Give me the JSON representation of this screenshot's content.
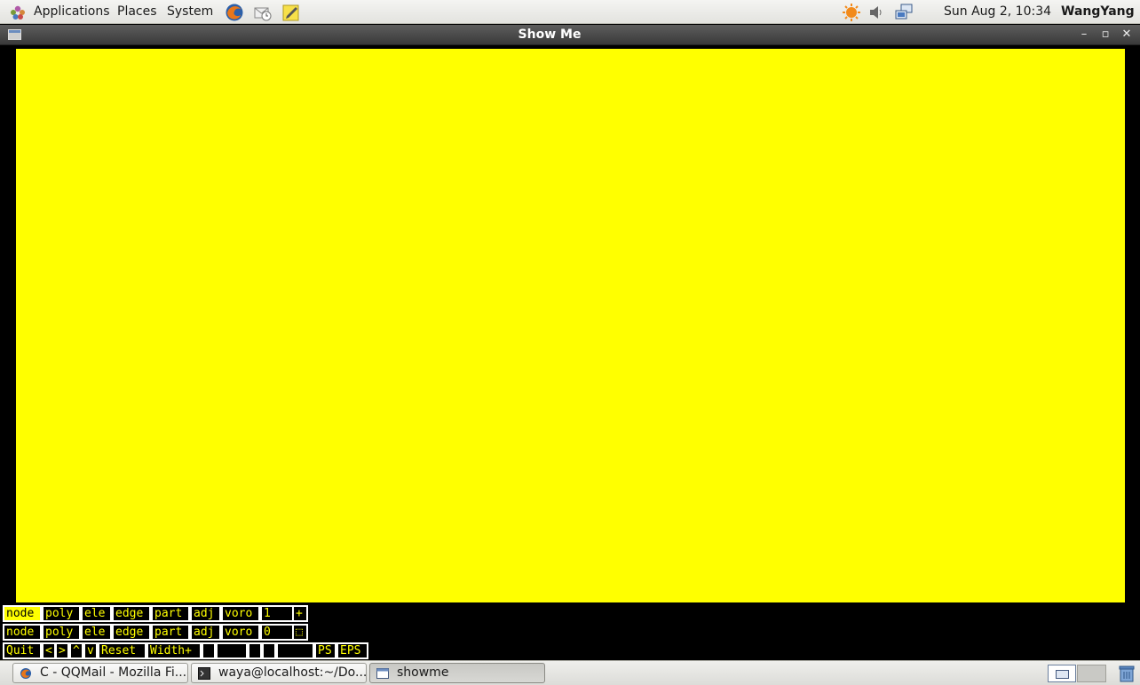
{
  "top_panel": {
    "menus": [
      "Applications",
      "Places",
      "System"
    ],
    "clock": "Sun Aug  2, 10:34",
    "user": "WangYang"
  },
  "window": {
    "title": "Show Me",
    "controls": {
      "minimize": "–",
      "maximize": "▫",
      "close": "✕"
    }
  },
  "colors": {
    "canvas": "#ffff00",
    "button_fg": "#ffff00",
    "button_bg": "#000000"
  },
  "showme": {
    "row1": [
      "node",
      "poly",
      "ele",
      "edge",
      "part",
      "adj",
      "voro",
      "1",
      "+"
    ],
    "row2": [
      "node",
      "poly",
      "ele",
      "edge",
      "part",
      "adj",
      "voro",
      "0",
      "⬚"
    ],
    "row3": [
      "Quit",
      "<",
      ">",
      "^",
      "v",
      "Reset",
      "Width+",
      "",
      "",
      "",
      "",
      "",
      "PS",
      "EPS"
    ]
  },
  "taskbar": {
    "tasks": [
      {
        "label": "C - QQMail - Mozilla Fi...",
        "icon": "firefox-icon"
      },
      {
        "label": "waya@localhost:~/Do...",
        "icon": "terminal-icon"
      },
      {
        "label": "showme",
        "icon": "window-icon"
      }
    ]
  }
}
